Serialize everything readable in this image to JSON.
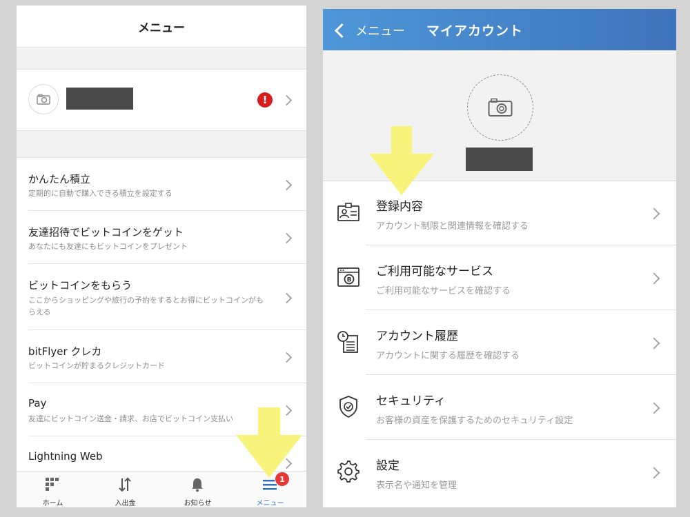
{
  "left": {
    "header_title": "メニュー",
    "menu_items": [
      {
        "title": "かんたん積立",
        "subtitle": "定期的に自動で購入できる積立を設定する"
      },
      {
        "title": "友達招待でビットコインをゲット",
        "subtitle": "あなたにも友達にもビットコインをプレゼント"
      },
      {
        "title": "ビットコインをもらう",
        "subtitle": "ここからショッピングや旅行の予約をするとお得にビットコインがもらえる"
      },
      {
        "title": "bitFlyer クレカ",
        "subtitle": "ビットコインが貯まるクレジットカード"
      },
      {
        "title": "Pay",
        "subtitle": "友達にビットコイン送金・請求、お店でビットコイン支払い"
      },
      {
        "title": "Lightning Web",
        "subtitle": ""
      }
    ],
    "profile_alert": "!",
    "tabs": [
      {
        "label": "ホーム",
        "icon": "home-grid-icon"
      },
      {
        "label": "入出金",
        "icon": "deposit-withdraw-arrows-icon"
      },
      {
        "label": "お知らせ",
        "icon": "bell-icon"
      },
      {
        "label": "メニュー",
        "icon": "hamburger-menu-icon"
      }
    ],
    "menu_badge": "1"
  },
  "right": {
    "back_label": "メニュー",
    "header_title": "マイアカウント",
    "items": [
      {
        "title": "登録内容",
        "subtitle": "アカウント制限と関連情報を確認する",
        "icon": "id-card-icon"
      },
      {
        "title": "ご利用可能なサービス",
        "subtitle": "ご利用可能なサービスを確認する",
        "icon": "bitcoin-browser-icon"
      },
      {
        "title": "アカウント履歴",
        "subtitle": "アカウントに関する履歴を確認する",
        "icon": "history-document-icon"
      },
      {
        "title": "セキュリティ",
        "subtitle": "お客様の資産を保護するためのセキュリティ設定",
        "icon": "shield-check-icon"
      },
      {
        "title": "設定",
        "subtitle": "表示名や通知を管理",
        "icon": "gear-icon"
      }
    ]
  },
  "colors": {
    "header_blue": "#4e96d8",
    "accent_arrow": "#f8f37a",
    "alert_red": "#d81e1e",
    "tab_active": "#2c6fc0"
  }
}
